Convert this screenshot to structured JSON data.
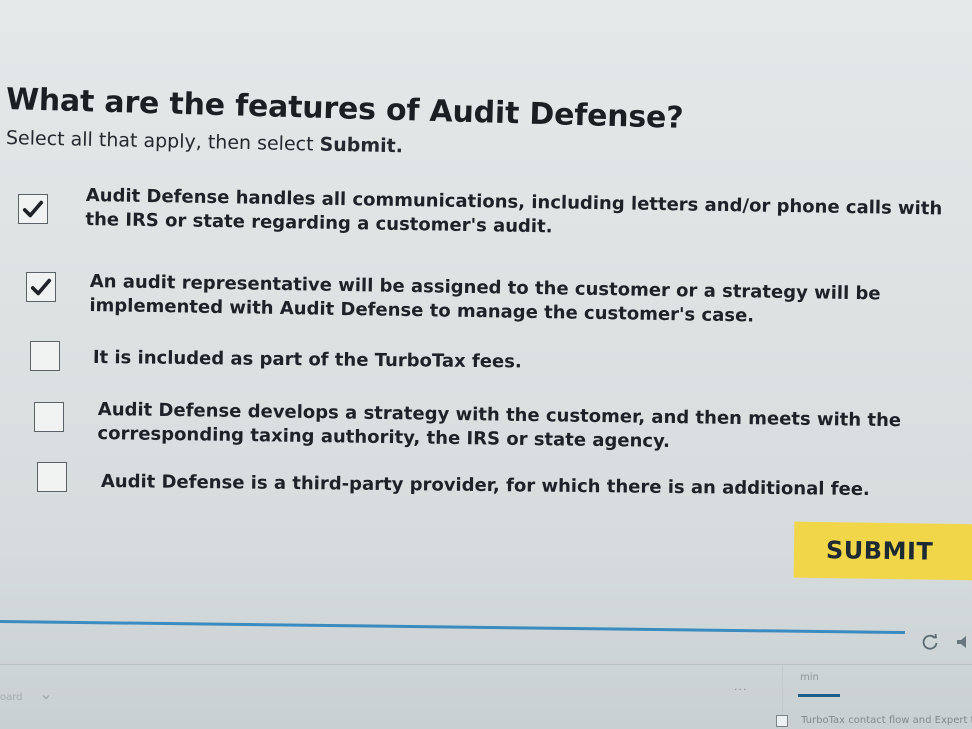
{
  "question": {
    "title": "What are the features of Audit Defense?",
    "instruction_prefix": "Select all that apply, then select ",
    "instruction_bold": "Submit."
  },
  "options": [
    {
      "text": "Audit Defense handles all communications, including letters and/or phone calls with\nthe IRS or state regarding a customer's audit.",
      "checked": true
    },
    {
      "text": "An audit representative will be assigned to the customer or a strategy will be\nimplemented with Audit Defense to manage the customer's case.",
      "checked": true
    },
    {
      "text": "It is included as part of the TurboTax fees.",
      "checked": false
    },
    {
      "text": "Audit Defense develops a strategy with the customer, and then meets with the\ncorresponding taxing authority, the IRS or state agency.",
      "checked": false
    },
    {
      "text": "Audit Defense is a third-party provider, for which there is an additional fee.",
      "checked": false
    }
  ],
  "submit_label": "SUBMIT",
  "toolbar": {
    "board_label": "oard",
    "more_label": "...",
    "min_label": "min",
    "contact_label": "TurboTax contact flow and Expert too",
    "contact_checked": false
  },
  "colors": {
    "submit_bg": "#f2d64a",
    "accent_rule": "#3a8bbf",
    "tab_underline": "#1e5f8a"
  },
  "icons": [
    "checkmark-icon",
    "refresh-icon",
    "volume-icon",
    "chevron-down-icon"
  ]
}
